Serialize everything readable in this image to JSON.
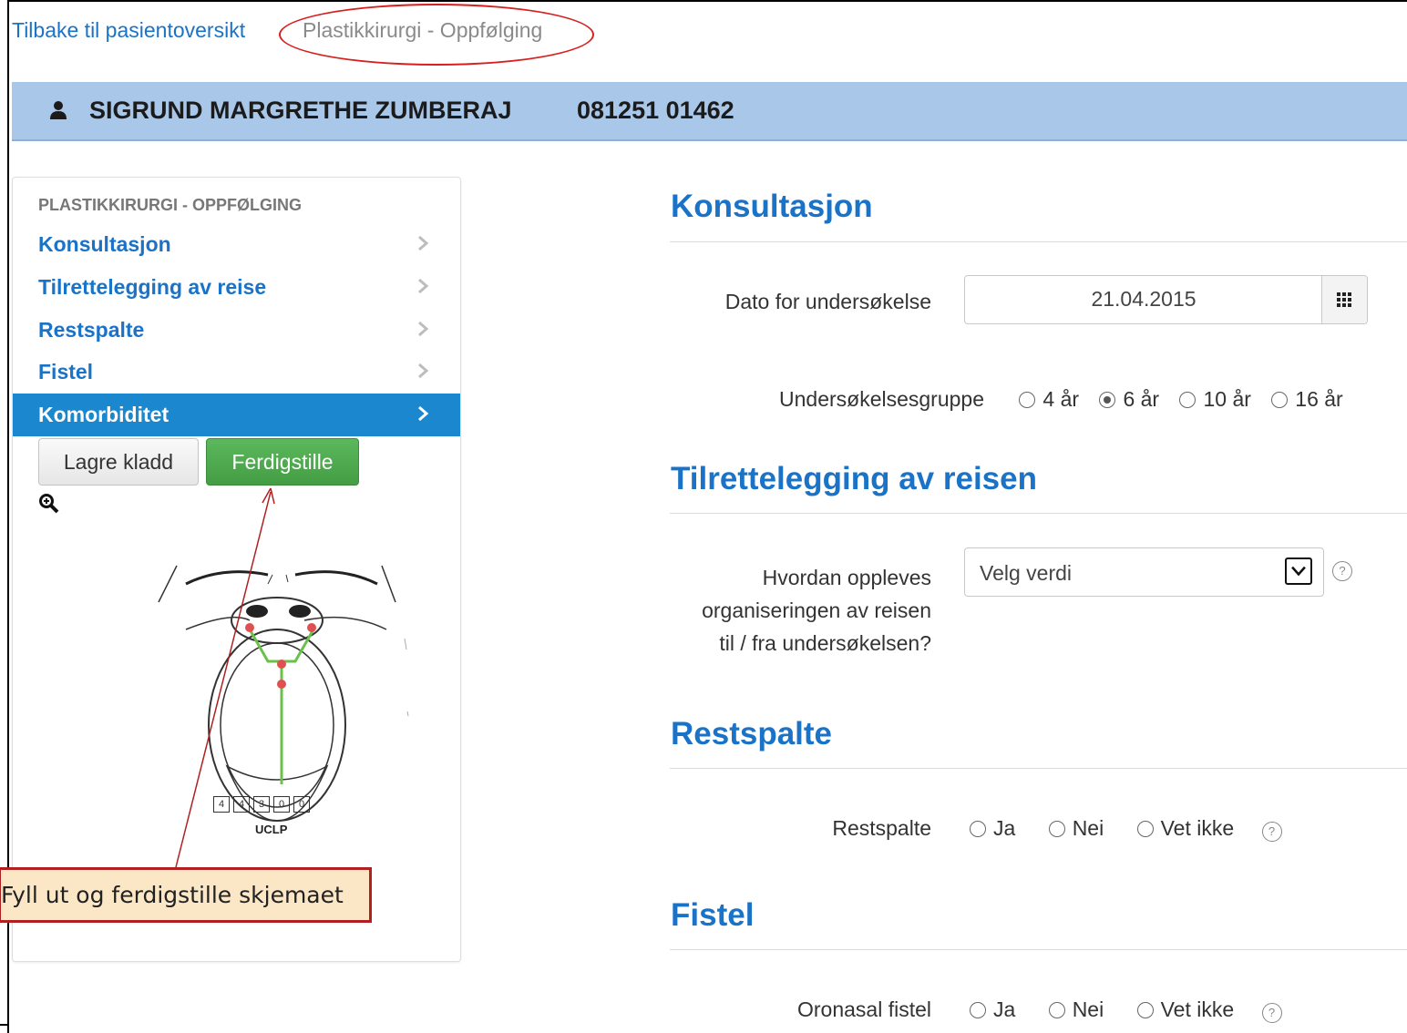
{
  "breadcrumb": {
    "back_link": "Tilbake til pasientoversikt",
    "current": "Plastikkirurgi - Oppfølging"
  },
  "patient": {
    "name": "SIGRUND MARGRETHE ZUMBERAJ",
    "id": "081251 01462",
    "icon": "user-icon"
  },
  "sidebar": {
    "heading": "PLASTIKKIRURGI - OPPFØLGING",
    "items": [
      {
        "label": "Konsultasjon",
        "active": false
      },
      {
        "label": "Tilrettelegging av reise",
        "active": false
      },
      {
        "label": "Restspalte",
        "active": false
      },
      {
        "label": "Fistel",
        "active": false
      },
      {
        "label": "Komorbiditet",
        "active": true
      }
    ],
    "draft_button": "Lagre kladd",
    "finish_button": "Ferdigstille",
    "scores": [
      "4",
      "4",
      "3",
      "0",
      "0"
    ],
    "diagram_label": "UCLP"
  },
  "callout": {
    "text": "Fyll ut og ferdigstille skjemaet"
  },
  "form": {
    "konsultasjon": {
      "title": "Konsultasjon",
      "date_label": "Dato for undersøkelse",
      "date_value": "21.04.2015",
      "group_label": "Undersøkelsesgruppe",
      "group_options": [
        "4 år",
        "6 år",
        "10 år",
        "16 år"
      ],
      "group_selected": "6 år"
    },
    "reise": {
      "title": "Tilrettelegging av reisen",
      "question_lines": [
        "Hvordan oppleves",
        "organiseringen av reisen",
        "til / fra undersøkelsen?"
      ],
      "select_value": "Velg verdi"
    },
    "restspalte": {
      "title": "Restspalte",
      "label": "Restspalte",
      "options": [
        "Ja",
        "Nei",
        "Vet ikke"
      ]
    },
    "fistel": {
      "title": "Fistel",
      "label": "Oronasal fistel",
      "options": [
        "Ja",
        "Nei",
        "Vet ikke"
      ]
    }
  },
  "colors": {
    "link": "#1a73c7",
    "patient_bar": "#a9c7e8",
    "active_nav": "#1a87cf",
    "success": "#5cb85c",
    "annotation_red": "#d81f1f"
  }
}
